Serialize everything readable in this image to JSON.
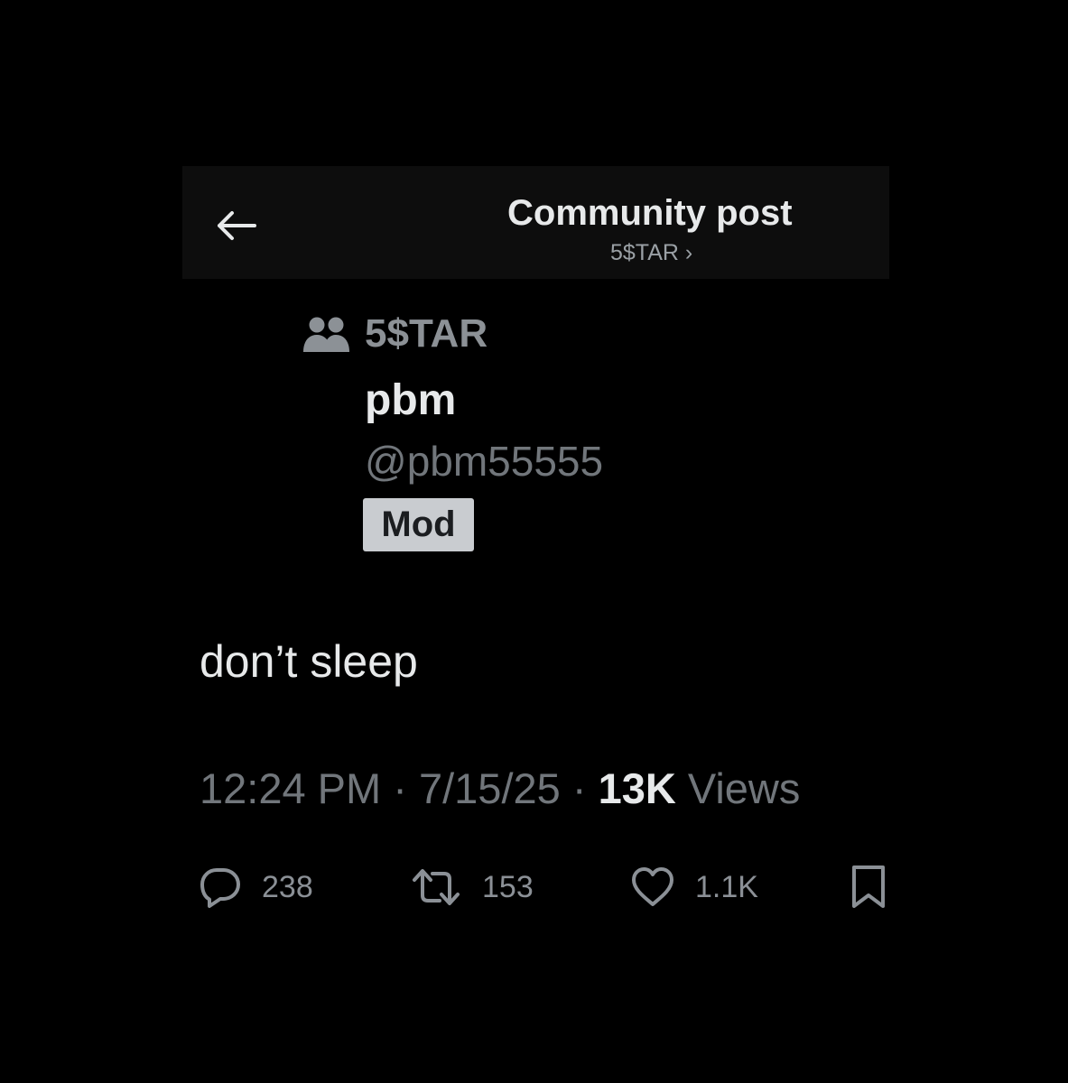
{
  "header": {
    "title": "Community post",
    "subtitle": "5$TAR ›",
    "back_icon": "arrow-left-icon"
  },
  "community": {
    "icon": "people-icon",
    "name": "5$TAR"
  },
  "author": {
    "display_name": "pbm",
    "handle": "@pbm55555",
    "badge": "Mod"
  },
  "post": {
    "text": "don’t sleep",
    "time": "12:24 PM",
    "separator": " · ",
    "date": "7/15/25",
    "views_count": "13K",
    "views_label": " Views"
  },
  "actions": {
    "replies": "238",
    "reposts": "153",
    "likes": "1.1K"
  },
  "colors": {
    "background": "#000000",
    "header_bg": "#0d0d0d",
    "primary_text": "#e7e9ea",
    "secondary_text": "#71767b",
    "badge_bg": "#c9ccd0"
  }
}
